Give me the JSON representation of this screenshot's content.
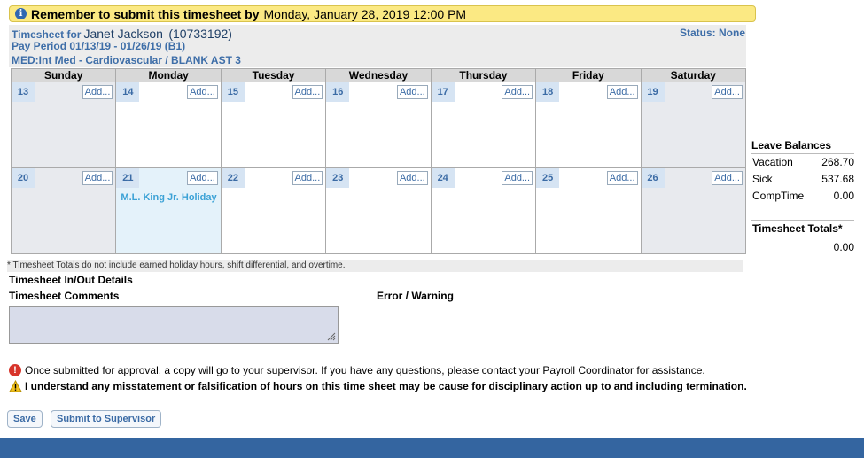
{
  "banner": {
    "bold": "Remember to submit this timesheet by",
    "deadline": "Monday, January 28, 2019 12:00 PM"
  },
  "header": {
    "label": "Timesheet for",
    "name": "Janet Jackson",
    "id": "(10733192)",
    "pay_period": "Pay Period 01/13/19 - 01/26/19 (B1)",
    "department": "MED:Int Med - Cardiovascular / BLANK AST 3",
    "status": "Status: None"
  },
  "calendar": {
    "days": [
      "Sunday",
      "Monday",
      "Tuesday",
      "Wednesday",
      "Thursday",
      "Friday",
      "Saturday"
    ],
    "add_label": "Add...",
    "weeks": [
      [
        "13",
        "14",
        "15",
        "16",
        "17",
        "18",
        "19"
      ],
      [
        "20",
        "21",
        "22",
        "23",
        "24",
        "25",
        "26"
      ]
    ],
    "holiday": "M.L. King Jr. Holiday"
  },
  "leave_balances": {
    "title": "Leave Balances",
    "items": [
      {
        "label": "Vacation",
        "value": "268.70"
      },
      {
        "label": "Sick",
        "value": "537.68"
      },
      {
        "label": "CompTime",
        "value": "0.00"
      }
    ]
  },
  "totals": {
    "title": "Timesheet Totals*",
    "value": "0.00"
  },
  "footnote": "* Timesheet Totals do not include earned holiday hours, shift differential, and overtime.",
  "sections": {
    "in_out": "Timesheet In/Out Details",
    "comments": "Timesheet Comments",
    "error": "Error / Warning"
  },
  "messages": {
    "info": "Once submitted for approval, a copy will go to your supervisor. If you have any questions, please contact your Payroll Coordinator for assistance.",
    "warning": "I understand any misstatement or falsification of hours on this time sheet may be cause for disciplinary action up to and including termination."
  },
  "buttons": {
    "save": "Save",
    "submit": "Submit to Supervisor"
  },
  "colors": {
    "banner": "#fbe983",
    "accent": "#3e6ea8",
    "holiday_text": "#3ba2d6",
    "footer": "#3465a0"
  }
}
